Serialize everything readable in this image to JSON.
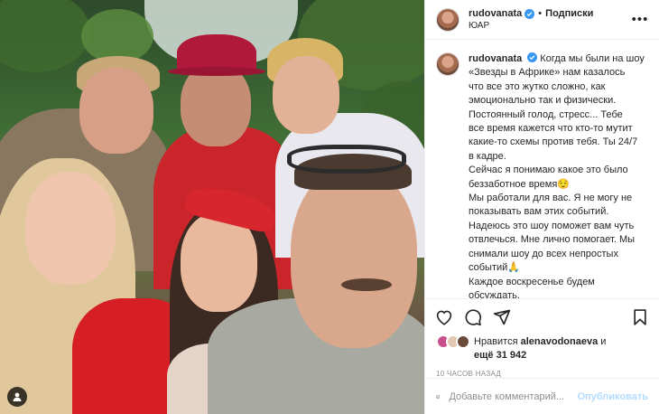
{
  "post": {
    "author": {
      "username": "rudovanata",
      "verified": true,
      "follow_state": "Подписки",
      "location": "ЮАР"
    },
    "caption": {
      "username": "rudovanata",
      "lines": [
        "Когда мы были на шоу",
        "«Звезды в Африке» нам казалось",
        "что все это жутко сложно, как",
        "эмоционально так и физически.",
        "Постоянный голод, стресс... Тебе",
        "все время кажется что кто-то мутит",
        "какие-то схемы против тебя. Ты 24/7",
        "в кадре.",
        "Сейчас я понимаю какое это было",
        "беззаботное время😌",
        "Мы работали для вас. Я не могу не",
        "показывать вам этих событий.",
        "Надеюсь это шоу поможет вам чуть",
        "отвлечься. Мне лично помогает. Мы",
        "снимали шоу до всех непростых",
        "событий🙏",
        "Каждое воскресенье будем",
        "обсуждать."
      ]
    },
    "likes": {
      "prefix": "Нравится",
      "user": "alenavodonaeva",
      "conjunction": "и",
      "more": "ещё 31 942"
    },
    "time": "10 ЧАСОВ НАЗАД",
    "comment": {
      "placeholder": "Добавьте комментарий...",
      "publish_label": "Опубликовать"
    },
    "icons": {
      "like": "heart-icon",
      "comment": "comment-icon",
      "share": "share-icon",
      "save": "bookmark-icon",
      "more": "more-icon",
      "emoji": "emoji-icon",
      "tag": "user-tag-icon"
    },
    "colors": {
      "verified": "#3897f0",
      "publish_disabled": "#b3dbff",
      "muted": "#8e8e8e"
    }
  }
}
